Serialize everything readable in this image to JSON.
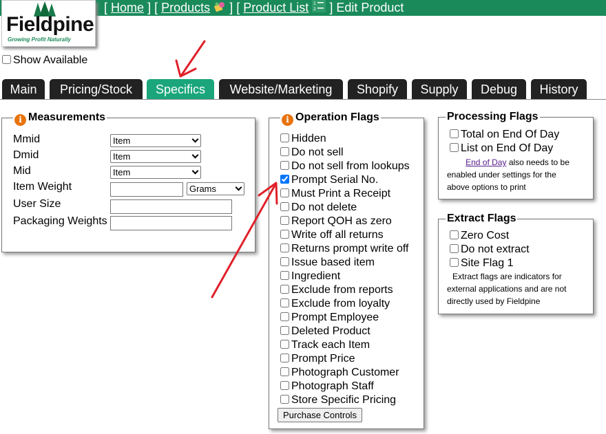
{
  "header": {
    "bracket_open": "[",
    "bracket_close": "]",
    "home_link": "Home",
    "products_link": "Products",
    "product_list_link": "Product List",
    "page_title": "Edit Product"
  },
  "logo": {
    "name": "Fieldpine",
    "tagline": "Growing Profit Naturally"
  },
  "show_available": {
    "label": "Show Available",
    "checked": false
  },
  "tabs": [
    {
      "label": "Main",
      "active": false
    },
    {
      "label": "Pricing/Stock",
      "active": false
    },
    {
      "label": "Specifics",
      "active": true
    },
    {
      "label": "Website/Marketing",
      "active": false
    },
    {
      "label": "Shopify",
      "active": false
    },
    {
      "label": "Supply",
      "active": false
    },
    {
      "label": "Debug",
      "active": false
    },
    {
      "label": "History",
      "active": false
    }
  ],
  "measurements": {
    "title": "Measurements",
    "info_icon": "i",
    "mmid_label": "Mmid",
    "mmid_value": "Item",
    "dmid_label": "Dmid",
    "dmid_value": "Item",
    "mid_label": "Mid",
    "mid_value": "Item",
    "item_weight_label": "Item Weight",
    "item_weight_value": "",
    "weight_unit": "Grams",
    "user_size_label": "User Size",
    "user_size_value": "",
    "packaging_weights_label": "Packaging Weights",
    "packaging_weights_value": ""
  },
  "operation_flags": {
    "title": "Operation Flags",
    "info_icon": "i",
    "items": [
      {
        "label": "Hidden",
        "checked": false
      },
      {
        "label": "Do not sell",
        "checked": false
      },
      {
        "label": "Do not sell from lookups",
        "checked": false
      },
      {
        "label": "Prompt Serial No.",
        "checked": true
      },
      {
        "label": "Must Print a Receipt",
        "checked": false
      },
      {
        "label": "Do not delete",
        "checked": false
      },
      {
        "label": "Report QOH as zero",
        "checked": false
      },
      {
        "label": "Write off all returns",
        "checked": false
      },
      {
        "label": "Returns prompt write off",
        "checked": false
      },
      {
        "label": "Issue based item",
        "checked": false
      },
      {
        "label": "Ingredient",
        "checked": false
      },
      {
        "label": "Exclude from reports",
        "checked": false
      },
      {
        "label": "Exclude from loyalty",
        "checked": false
      },
      {
        "label": "Prompt Employee",
        "checked": false
      },
      {
        "label": "Deleted Product",
        "checked": false
      },
      {
        "label": "Track each Item",
        "checked": false
      },
      {
        "label": "Prompt Price",
        "checked": false
      },
      {
        "label": "Photograph Customer",
        "checked": false
      },
      {
        "label": "Photograph Staff",
        "checked": false
      },
      {
        "label": "Store Specific Pricing",
        "checked": false
      }
    ],
    "purchase_controls_button": "Purchase Controls"
  },
  "processing_flags": {
    "title": "Processing Flags",
    "items": [
      {
        "label": "Total on End Of Day",
        "checked": false
      },
      {
        "label": "List on End Of Day",
        "checked": false
      }
    ],
    "note_link": "End of Day",
    "note_line1": " also needs to be",
    "note_line2": "enabled under settings for the",
    "note_line3": "above options to print"
  },
  "extract_flags": {
    "title": "Extract Flags",
    "items": [
      {
        "label": "Zero Cost",
        "checked": false
      },
      {
        "label": "Do not extract",
        "checked": false
      },
      {
        "label": "Site Flag 1",
        "checked": false
      }
    ],
    "note_line1": "Extract flags are indicators for",
    "note_line2": "external applications and are not",
    "note_line3": "directly used by Fieldpine"
  },
  "annotation_color": "#e0202a"
}
